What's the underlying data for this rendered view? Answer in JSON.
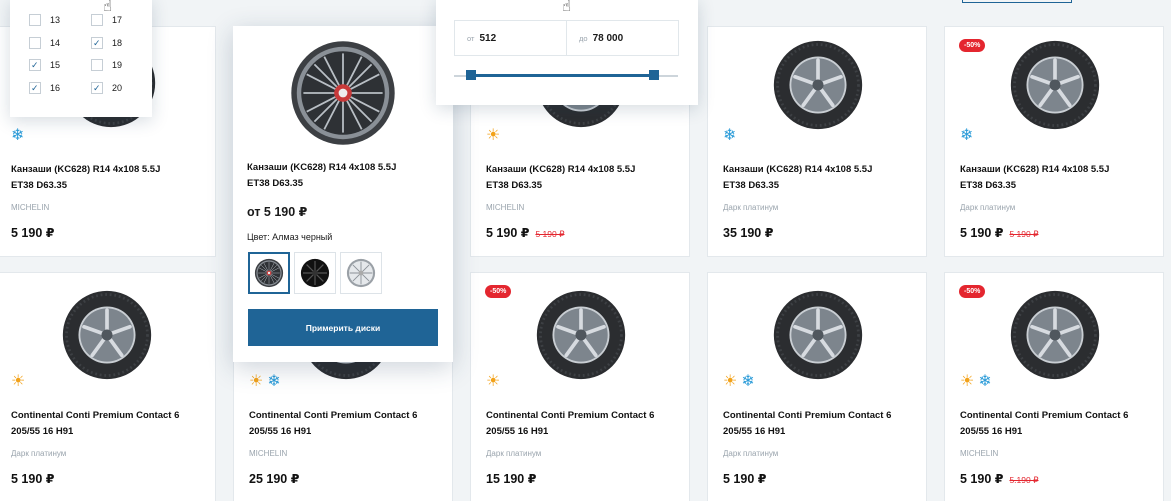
{
  "size_filter": {
    "options": [
      {
        "label": "13",
        "checked": false
      },
      {
        "label": "17",
        "checked": false
      },
      {
        "label": "14",
        "checked": false
      },
      {
        "label": "18",
        "checked": true
      },
      {
        "label": "15",
        "checked": true
      },
      {
        "label": "19",
        "checked": false
      },
      {
        "label": "16",
        "checked": true
      },
      {
        "label": "20",
        "checked": true
      }
    ]
  },
  "price_filter": {
    "from_prefix": "от",
    "from_value": "512",
    "to_prefix": "до",
    "to_value": "78 000"
  },
  "popup_card": {
    "title_line1": "Канзаши (KC628) R14 4x108 5.5J",
    "title_line2": "ET38 D63.35",
    "price_from": "от 5 190 ₽",
    "color_label": "Цвет: Алмаз черный",
    "try_button": "Примерить диски"
  },
  "products": [
    {
      "title_line1": "Канзаши (KC628) R14 4x108 5.5J",
      "title_line2": "ET38 D63.35",
      "brand": "MICHELIN",
      "price": "5 190 ₽",
      "season": "winter"
    },
    {
      "title_line1": "Канзаши (KC628) R14 4x108 5.5J",
      "title_line2": "ET38 D63.35",
      "brand": "MICHELIN",
      "price": "5 190 ₽",
      "old_price": "5 190 ₽",
      "season": "summer"
    },
    {
      "title_line1": "Канзаши (KC628) R14 4x108 5.5J",
      "title_line2": "ET38 D63.35",
      "brand": "Дарк платинум",
      "price": "35 190 ₽",
      "season": "winter"
    },
    {
      "title_line1": "Канзаши (KC628) R14 4x108 5.5J",
      "title_line2": "ET38 D63.35",
      "brand": "Дарк платинум",
      "price": "5 190 ₽",
      "old_price": "5 190 ₽",
      "badge": "-50%",
      "season": "winter"
    },
    {
      "title_line1": "Continental Conti Premium Contact 6",
      "title_line2": "205/55 16 H91",
      "brand": "Дарк платинум",
      "price": "5 190 ₽",
      "season": "summer"
    },
    {
      "title_line1": "Continental Conti Premium Contact 6",
      "title_line2": "205/55 16 H91",
      "brand": "MICHELIN",
      "price": "25 190 ₽",
      "season": "all"
    },
    {
      "title_line1": "Continental Conti Premium Contact 6",
      "title_line2": "205/55 16 H91",
      "brand": "Дарк платинум",
      "price": "15 190 ₽",
      "badge": "-50%",
      "season": "summer"
    },
    {
      "title_line1": "Continental Conti Premium Contact 6",
      "title_line2": "205/55 16 H91",
      "brand": "Дарк платинум",
      "price": "5 190 ₽",
      "season": "all"
    },
    {
      "title_line1": "Continental Conti Premium Contact 6",
      "title_line2": "205/55 16 H91",
      "brand": "MICHELIN",
      "price": "5 190 ₽",
      "old_price": "5.190 ₽",
      "badge": "-50%",
      "season": "all"
    }
  ],
  "icons": {
    "summer": "sun-icon",
    "winter": "snowflake-icon",
    "cursor": "hand-pointer-icon"
  },
  "colors": {
    "accent": "#1f6496",
    "sale": "#e4262f",
    "summer": "#f2a21a",
    "winter": "#2a9bd8"
  }
}
